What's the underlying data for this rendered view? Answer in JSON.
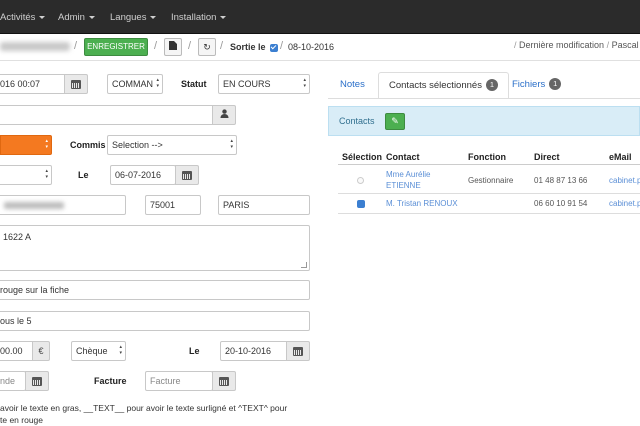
{
  "nav": {
    "items": [
      {
        "label": "Activités"
      },
      {
        "label": "Admin"
      },
      {
        "label": "Langues"
      },
      {
        "label": "Installation"
      }
    ]
  },
  "toolbar": {
    "save_label": "ENREGISTRER",
    "sortie_label": "Sortie le",
    "date": "08-10-2016",
    "last_modified_label": "Dernière modification",
    "last_modified_user": "Pascal B"
  },
  "form": {
    "date_time": "016 00:07",
    "type_value": "COMMAN",
    "statut_label": "Statut",
    "statut_value": "EN COURS",
    "commis_label": "Commis",
    "commis_value": "Selection -->",
    "le_label": "Le",
    "le_date": "06-07-2016",
    "postal_code": "75001",
    "city": "PARIS",
    "textarea_text": "1622 A",
    "note1": "rouge sur la fiche",
    "note2": "ous le 5",
    "amount": "00.00",
    "currency": "€",
    "payment_method": "Chèque",
    "le2_label": "Le",
    "le2_date": "20-10-2016",
    "order_placeholder": "nde",
    "facture_label": "Facture",
    "facture_placeholder": "Facture",
    "help_line1": "avoir le texte en gras, __TEXT__ pour avoir le texte surligné et ^TEXT^ pour",
    "help_line2": "te en rouge"
  },
  "tabs": {
    "notes": "Notes",
    "contacts": "Contacts sélectionnés",
    "contacts_count": "1",
    "files": "Fichiers",
    "files_count": "1"
  },
  "contacts": {
    "title": "Contacts",
    "columns": [
      "Sélection",
      "Contact",
      "Fonction",
      "Direct",
      "eMail"
    ],
    "rows": [
      {
        "name_line1": "Mme Aurélie",
        "name_line2": "ETIENNE",
        "function": "Gestionnaire",
        "direct": "01 48 87 13 66",
        "email": "cabinet.p"
      },
      {
        "name_line1": "M. Tristan RENOUX",
        "name_line2": "",
        "function": "",
        "direct": "06 60 10 91 54",
        "email": "cabinet.p"
      }
    ]
  }
}
